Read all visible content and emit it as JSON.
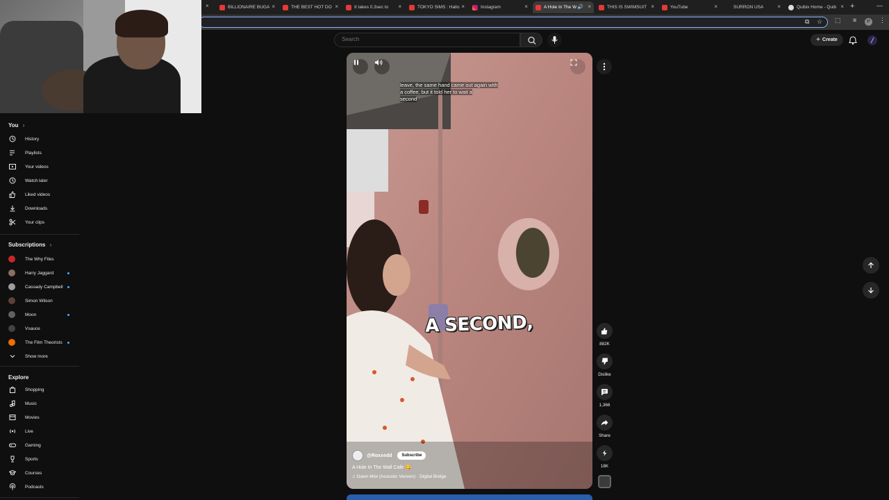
{
  "browser": {
    "tabs": [
      {
        "title": "BILLIONAIRE BUGA",
        "favicon": "yt"
      },
      {
        "title": "THE BEST HOT DO",
        "favicon": "yt"
      },
      {
        "title": "It takes 0.3sec to",
        "favicon": "yt"
      },
      {
        "title": "TOKYO SIMS : Hallo",
        "favicon": "yt"
      },
      {
        "title": "Instagram",
        "favicon": "ig"
      },
      {
        "title": "A Hole In The W",
        "favicon": "yt",
        "active": true
      },
      {
        "title": "THIS IS SWIMSUIT",
        "favicon": "yt"
      },
      {
        "title": "YouTube",
        "favicon": "yt"
      },
      {
        "title": "SURRON USA",
        "favicon": "none"
      },
      {
        "title": "Quibix Home - Quib",
        "favicon": "qb"
      }
    ],
    "new_tab_icon": "plus-icon",
    "profile_initial": "P"
  },
  "header": {
    "search_placeholder": "Search",
    "create_label": "Create"
  },
  "sidebar": {
    "you": {
      "title": "You",
      "items": [
        {
          "label": "History",
          "icon": "history-icon"
        },
        {
          "label": "Playlists",
          "icon": "playlists-icon"
        },
        {
          "label": "Your videos",
          "icon": "your-videos-icon"
        },
        {
          "label": "Watch later",
          "icon": "watch-later-icon"
        },
        {
          "label": "Liked videos",
          "icon": "like-icon"
        },
        {
          "label": "Downloads",
          "icon": "download-icon"
        },
        {
          "label": "Your clips",
          "icon": "scissors-icon"
        }
      ]
    },
    "subscriptions": {
      "title": "Subscriptions",
      "items": [
        {
          "label": "The Why Files",
          "color": "#c62828",
          "dot": false
        },
        {
          "label": "Harry Jaggard",
          "color": "#8d6e63",
          "dot": true
        },
        {
          "label": "Cassady Campbell",
          "color": "#9e9e9e",
          "dot": true
        },
        {
          "label": "Simon Wilson",
          "color": "#5d4037",
          "dot": false
        },
        {
          "label": "Moon",
          "color": "#616161",
          "dot": true
        },
        {
          "label": "Vsauce",
          "color": "#424242",
          "dot": false
        },
        {
          "label": "The Film Theorists",
          "color": "#ef6c00",
          "dot": true
        }
      ],
      "show_more": "Show more"
    },
    "explore": {
      "title": "Explore",
      "items": [
        {
          "label": "Shopping",
          "icon": "shopping-bag-icon"
        },
        {
          "label": "Music",
          "icon": "music-note-icon"
        },
        {
          "label": "Movies",
          "icon": "film-icon"
        },
        {
          "label": "Live",
          "icon": "live-icon"
        },
        {
          "label": "Gaming",
          "icon": "gamepad-icon"
        },
        {
          "label": "Sports",
          "icon": "trophy-icon"
        },
        {
          "label": "Courses",
          "icon": "courses-icon"
        },
        {
          "label": "Podcasts",
          "icon": "podcast-icon"
        }
      ]
    }
  },
  "video": {
    "caption_top_line1": "leave, the same hand came out again with",
    "caption_top_line2": "a coffee, but it told her to wait a",
    "caption_top_line3": "second",
    "caption_big": "A SECOND,",
    "channel_handle": "@Roxxedd",
    "subscribe_label": "Subscribe",
    "title": "A Hole In The Wall Cafe 😋",
    "music": "♫ Dawn Mist (Acoustic Version) · Digital Bridge"
  },
  "actions": {
    "likes": "882K",
    "dislike_label": "Dislike",
    "comments": "1,366",
    "share_label": "Share",
    "remixes": "18K"
  },
  "colors": {
    "accent": "#3ea6ff",
    "youtube_red": "#ff0000",
    "background": "#0f0f0f"
  }
}
